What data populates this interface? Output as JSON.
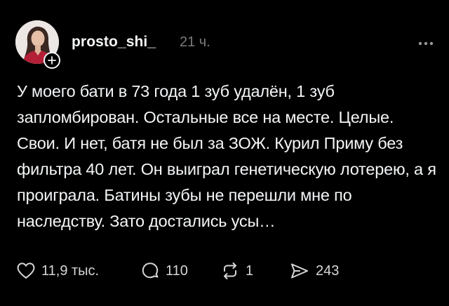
{
  "post": {
    "username": "prosto_shi_",
    "timestamp": "21 ч.",
    "text": "У моего бати в 73 года 1 зуб удалён, 1 зуб запломбирован. Остальные все на месте. Целые. Свои. И нет, батя не был за ЗОЖ. Курил Приму без фильтра 40 лет. Он выиграл генетическую лотерею, а я проиграла. Батины зубы не перешли мне по наследству. Зато достались усы…",
    "avatar_icon": "profile-photo",
    "follow_icon": "plus-icon",
    "more_icon": "more-horizontal-icon"
  },
  "actions": {
    "likes": "11,9 тыс.",
    "replies": "110",
    "reposts": "1",
    "shares": "243"
  },
  "colors": {
    "background": "#000000",
    "text": "#f3f5f7",
    "secondary_text": "#7a7a7a",
    "counts": "#d6d6d6"
  }
}
